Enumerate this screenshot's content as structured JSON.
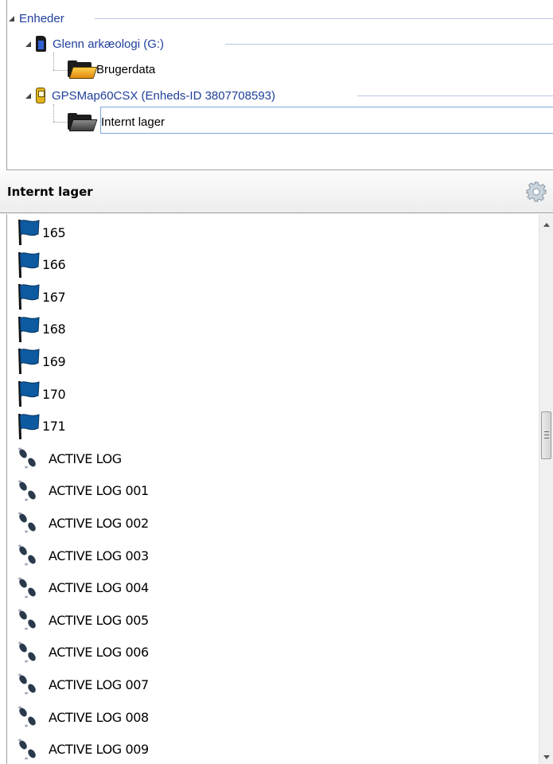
{
  "tree": {
    "root_label": "Enheder",
    "devices": [
      {
        "label": "Glenn arkæologi (G:)",
        "icon": "sd-card-icon",
        "children": [
          {
            "label": "Brugerdata",
            "icon": "folder-icon"
          }
        ]
      },
      {
        "label": "GPSMap60CSX (Enheds-ID 3807708593)",
        "icon": "gps-device-icon",
        "children": [
          {
            "label": "Internt lager",
            "icon": "folder-open-icon"
          }
        ]
      }
    ]
  },
  "list_header": {
    "title": "Internt lager",
    "settings_icon": "gear-icon"
  },
  "list": {
    "waypoints": [
      {
        "label": "165",
        "icon": "flag-icon"
      },
      {
        "label": "166",
        "icon": "flag-icon"
      },
      {
        "label": "167",
        "icon": "flag-icon"
      },
      {
        "label": "168",
        "icon": "flag-icon"
      },
      {
        "label": "169",
        "icon": "flag-icon"
      },
      {
        "label": "170",
        "icon": "flag-icon"
      },
      {
        "label": "171",
        "icon": "flag-icon"
      }
    ],
    "tracks": [
      {
        "label": "ACTIVE LOG",
        "icon": "footprints-icon"
      },
      {
        "label": "ACTIVE LOG 001",
        "icon": "footprints-icon"
      },
      {
        "label": "ACTIVE LOG 002",
        "icon": "footprints-icon"
      },
      {
        "label": "ACTIVE LOG 003",
        "icon": "footprints-icon"
      },
      {
        "label": "ACTIVE LOG 004",
        "icon": "footprints-icon"
      },
      {
        "label": "ACTIVE LOG 005",
        "icon": "footprints-icon"
      },
      {
        "label": "ACTIVE LOG 006",
        "icon": "footprints-icon"
      },
      {
        "label": "ACTIVE LOG 007",
        "icon": "footprints-icon"
      },
      {
        "label": "ACTIVE LOG 008",
        "icon": "footprints-icon"
      },
      {
        "label": "ACTIVE LOG 009",
        "icon": "footprints-icon"
      }
    ]
  },
  "colors": {
    "flag": "#0d5aa0",
    "group_text": "#1f3f9b",
    "selection_border": "#7aa7d9"
  }
}
